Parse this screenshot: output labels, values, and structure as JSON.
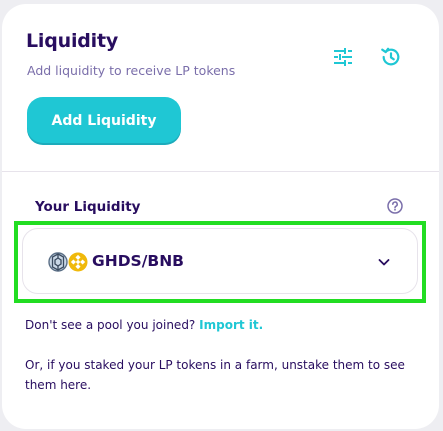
{
  "header": {
    "title": "Liquidity",
    "subtitle": "Add liquidity to receive LP tokens",
    "add_button_label": "Add Liquidity",
    "settings_icon": "settings-sliders-icon",
    "history_icon": "history-icon"
  },
  "your_liquidity": {
    "label": "Your Liquidity",
    "help_icon": "question-circle-icon",
    "pools": [
      {
        "name": "GHDS/BNB",
        "token_a_icon": "ghds-token-icon",
        "token_b_icon": "bnb-token-icon"
      }
    ]
  },
  "footer": {
    "prompt_text": "Don't see a pool you joined?",
    "import_link": "Import it.",
    "staked_note": "Or, if you staked your LP tokens in a farm, unstake them to see them here."
  },
  "colors": {
    "primary": "#1fc7d4",
    "text": "#280d5f",
    "subtle_text": "#7a6eaa",
    "bnb": "#f0b90b",
    "highlight": "#22dd22"
  }
}
